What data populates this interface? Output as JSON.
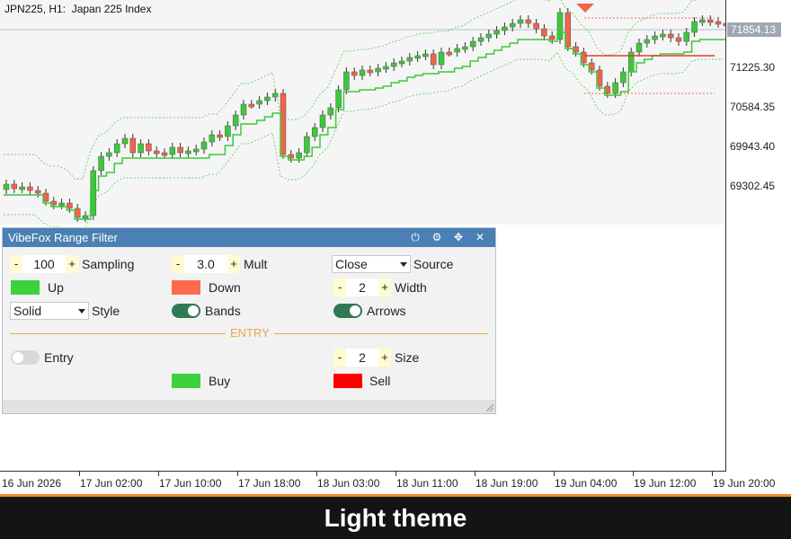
{
  "chart": {
    "title": "JPN225, H1:  Japan 225 Index",
    "price_labels": [
      "71225.30",
      "70584.35",
      "69943.40",
      "69302.45"
    ],
    "current_price": "71854.13",
    "time_labels": [
      "16 Jun 2026",
      "17 Jun 02:00",
      "17 Jun 10:00",
      "17 Jun 18:00",
      "18 Jun 03:00",
      "18 Jun 11:00",
      "18 Jun 19:00",
      "19 Jun 04:00",
      "19 Jun 12:00",
      "19 Jun 20:00"
    ],
    "colors": {
      "up": "#3cc83c",
      "down": "#f0644a",
      "bands": "#3cc83c",
      "range_down": "#e33c2c",
      "arrow": "#f0644a"
    }
  },
  "panel": {
    "title": "VibeFox Range Filter",
    "header_icons": [
      "power-icon",
      "gear-icon",
      "move-icon",
      "close-icon"
    ],
    "sampling": {
      "value": "100",
      "label": "Sampling"
    },
    "mult": {
      "value": "3.0",
      "label": "Mult"
    },
    "source": {
      "value": "Close",
      "label": "Source"
    },
    "up": {
      "label": "Up",
      "color": "#3cd23c"
    },
    "down": {
      "label": "Down",
      "color": "#ff6a4d"
    },
    "width": {
      "value": "2",
      "label": "Width"
    },
    "style": {
      "value": "Solid",
      "label": "Style"
    },
    "bands": {
      "label": "Bands",
      "on": true
    },
    "arrows": {
      "label": "Arrows",
      "on": true
    },
    "section_entry": "ENTRY",
    "entry": {
      "label": "Entry",
      "on": false
    },
    "size": {
      "value": "2",
      "label": "Size"
    },
    "buy": {
      "label": "Buy",
      "color": "#3cd23c"
    },
    "sell": {
      "label": "Sell",
      "color": "#ff0000"
    },
    "stepper_minus": "-",
    "stepper_plus": "+"
  },
  "banner": {
    "text": "Light theme"
  }
}
